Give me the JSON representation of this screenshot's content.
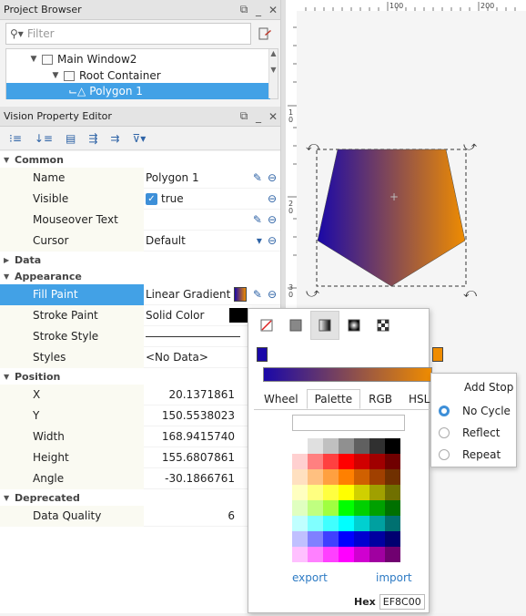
{
  "project_browser": {
    "title": "Project Browser",
    "filter_placeholder": "Filter",
    "tree": [
      {
        "label": "Main Window2"
      },
      {
        "label": "Root Container"
      },
      {
        "label": "Polygon 1"
      }
    ]
  },
  "property_editor": {
    "title": "Vision Property Editor",
    "sections": {
      "common": "Common",
      "data": "Data",
      "appearance": "Appearance",
      "position": "Position",
      "deprecated": "Deprecated"
    },
    "props": {
      "name": {
        "label": "Name",
        "value": "Polygon 1"
      },
      "visible": {
        "label": "Visible",
        "value": "true"
      },
      "mouseover": {
        "label": "Mouseover Text",
        "value": ""
      },
      "cursor": {
        "label": "Cursor",
        "value": "Default"
      },
      "fill_paint": {
        "label": "Fill Paint",
        "value": "Linear Gradient"
      },
      "stroke_paint": {
        "label": "Stroke Paint",
        "value": "Solid Color"
      },
      "stroke_style": {
        "label": "Stroke Style",
        "value": ""
      },
      "styles": {
        "label": "Styles",
        "value": "<No Data>"
      },
      "x": {
        "label": "X",
        "value": "20.1371861"
      },
      "y": {
        "label": "Y",
        "value": "150.5538023"
      },
      "width": {
        "label": "Width",
        "value": "168.9415740"
      },
      "height": {
        "label": "Height",
        "value": "155.6807861"
      },
      "angle": {
        "label": "Angle",
        "value": "-30.1866761"
      },
      "data_quality": {
        "label": "Data Quality",
        "value": "6"
      }
    }
  },
  "ruler": {
    "tick_100": "100",
    "tick_200": "200",
    "v1": "1",
    "v0a": "0",
    "v2": "2",
    "v0b": "0",
    "v3": "3",
    "v0c": "0"
  },
  "paint_popup": {
    "tabs": [
      "Wheel",
      "Palette",
      "RGB",
      "HSL"
    ],
    "selected_tab": "Palette",
    "export_label": "export",
    "import_label": "import",
    "hex_label": "Hex",
    "hex_value": "EF8C00",
    "gradient_start": "#1a08a8",
    "gradient_end": "#ef8c00"
  },
  "context_menu": {
    "add_stop": "Add Stop",
    "no_cycle": "No Cycle",
    "reflect": "Reflect",
    "repeat": "Repeat"
  },
  "palette": [
    "#ffffff",
    "#e0e0e0",
    "#c0c0c0",
    "#909090",
    "#606060",
    "#303030",
    "#000000",
    "#ffd0d0",
    "#ff8080",
    "#ff4040",
    "#ff0000",
    "#d00000",
    "#a00000",
    "#700000",
    "#ffe0c0",
    "#ffc080",
    "#ffa040",
    "#ff8000",
    "#d06000",
    "#a04000",
    "#703000",
    "#ffffc0",
    "#ffff80",
    "#ffff40",
    "#ffff00",
    "#d0d000",
    "#a0a000",
    "#707000",
    "#e0ffc0",
    "#c0ff80",
    "#a0ff40",
    "#00ff00",
    "#00d000",
    "#00a000",
    "#007000",
    "#c0ffff",
    "#80ffff",
    "#40ffff",
    "#00ffff",
    "#00d0d0",
    "#00a0a0",
    "#007070",
    "#c0c0ff",
    "#8080ff",
    "#4040ff",
    "#0000ff",
    "#0000d0",
    "#0000a0",
    "#000070",
    "#ffc0ff",
    "#ff80ff",
    "#ff40ff",
    "#ff00ff",
    "#d000d0",
    "#a000a0",
    "#700070"
  ]
}
